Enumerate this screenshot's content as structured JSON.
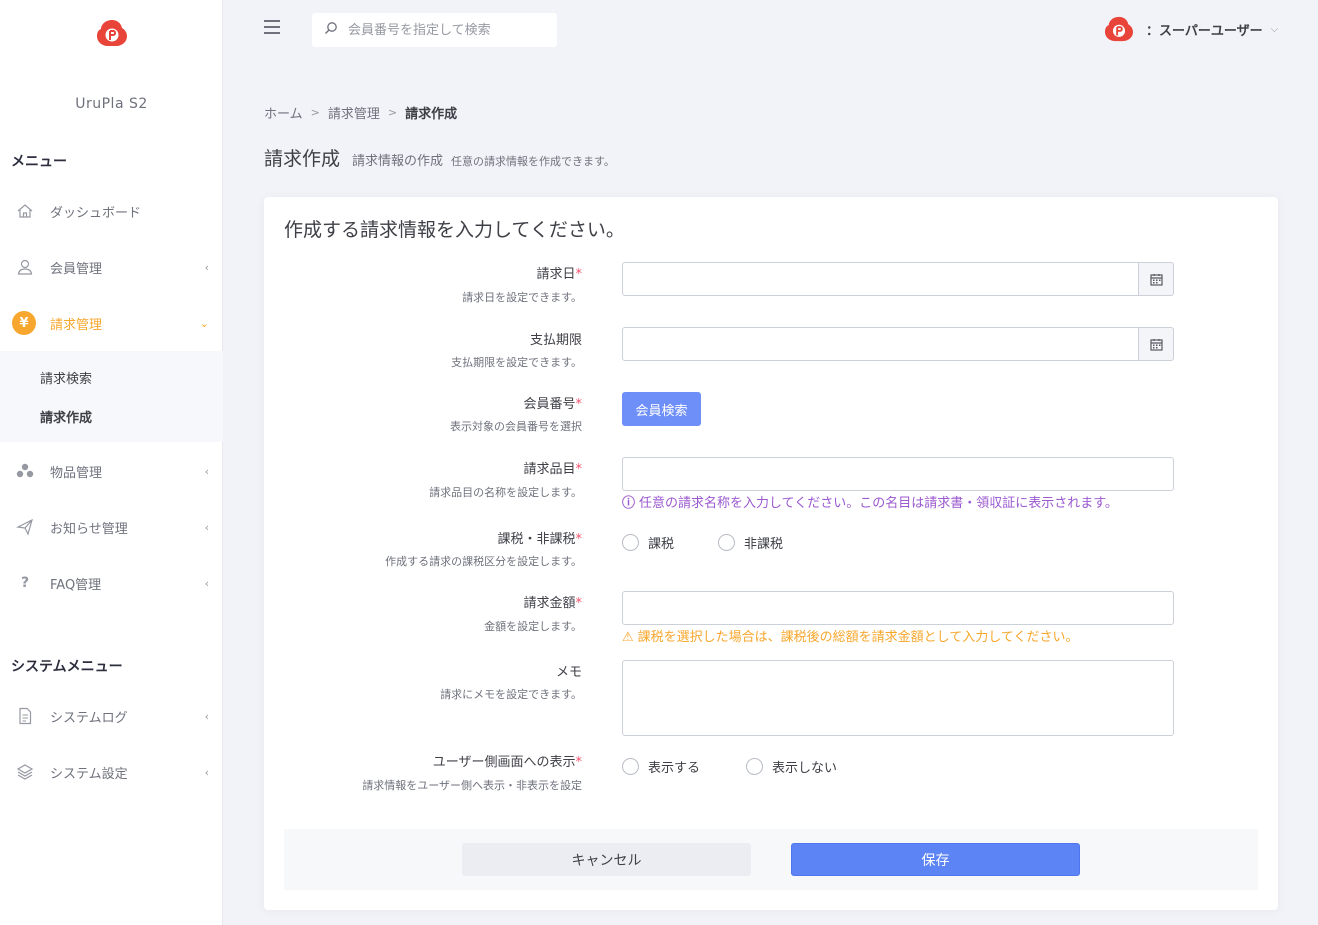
{
  "app": {
    "name": "UruPla S2"
  },
  "sidebar": {
    "menu_title": "メニュー",
    "system_title": "システムメニュー",
    "items": [
      {
        "label": "ダッシュボード",
        "icon": "home-icon"
      },
      {
        "label": "会員管理",
        "icon": "user-icon"
      },
      {
        "label": "請求管理",
        "icon": "yen-icon",
        "active": true
      },
      {
        "label": "物品管理",
        "icon": "boxes-icon"
      },
      {
        "label": "お知らせ管理",
        "icon": "paper-plane-icon"
      },
      {
        "label": "FAQ管理",
        "icon": "question-icon"
      }
    ],
    "submenu": [
      {
        "label": "請求検索"
      },
      {
        "label": "請求作成"
      }
    ],
    "system_items": [
      {
        "label": "システムログ",
        "icon": "document-icon"
      },
      {
        "label": "システム設定",
        "icon": "layers-icon"
      }
    ],
    "yen_glyph": "¥",
    "question_glyph": "?"
  },
  "topbar": {
    "search_placeholder": "会員番号を指定して検索",
    "user_name": "：スーパーユーザー"
  },
  "breadcrumb": {
    "home": "ホーム",
    "parent": "請求管理",
    "current": "請求作成"
  },
  "page": {
    "title": "請求作成",
    "subtitle": "請求情報の作成",
    "description": "任意の請求情報を作成できます。"
  },
  "form": {
    "heading": "作成する請求情報を入力してください。",
    "required_mark": "*",
    "fields": {
      "invoice_date": {
        "label": "請求日",
        "help": "請求日を設定できます。"
      },
      "due_date": {
        "label": "支払期限",
        "help": "支払期限を設定できます。"
      },
      "member_no": {
        "label": "会員番号",
        "help": "表示対象の会員番号を選択",
        "button": "会員検索"
      },
      "item": {
        "label": "請求品目",
        "help": "請求品目の名称を設定します。",
        "hint": "任意の請求名称を入力してください。この名目は請求書・領収証に表示されます。"
      },
      "tax": {
        "label": "課税・非課税",
        "help": "作成する請求の課税区分を設定します。",
        "options": [
          "課税",
          "非課税"
        ]
      },
      "amount": {
        "label": "請求金額",
        "help": "金額を設定します。",
        "hint": "課税を選択した場合は、課税後の総額を請求金額として入力してください。"
      },
      "memo": {
        "label": "メモ",
        "help": "請求にメモを設定できます。"
      },
      "visibility": {
        "label": "ユーザー側画面への表示",
        "help": "請求情報をユーザー側へ表示・非表示を設定",
        "options": [
          "表示する",
          "表示しない"
        ]
      }
    },
    "cancel_label": "キャンセル",
    "save_label": "保存"
  },
  "colors": {
    "accent": "#f7a72d",
    "primary": "#5d84f5",
    "required": "#f4516c",
    "hint_info": "#9b59d0",
    "hint_warning": "#f7a72d",
    "logo": "#e8443a"
  }
}
